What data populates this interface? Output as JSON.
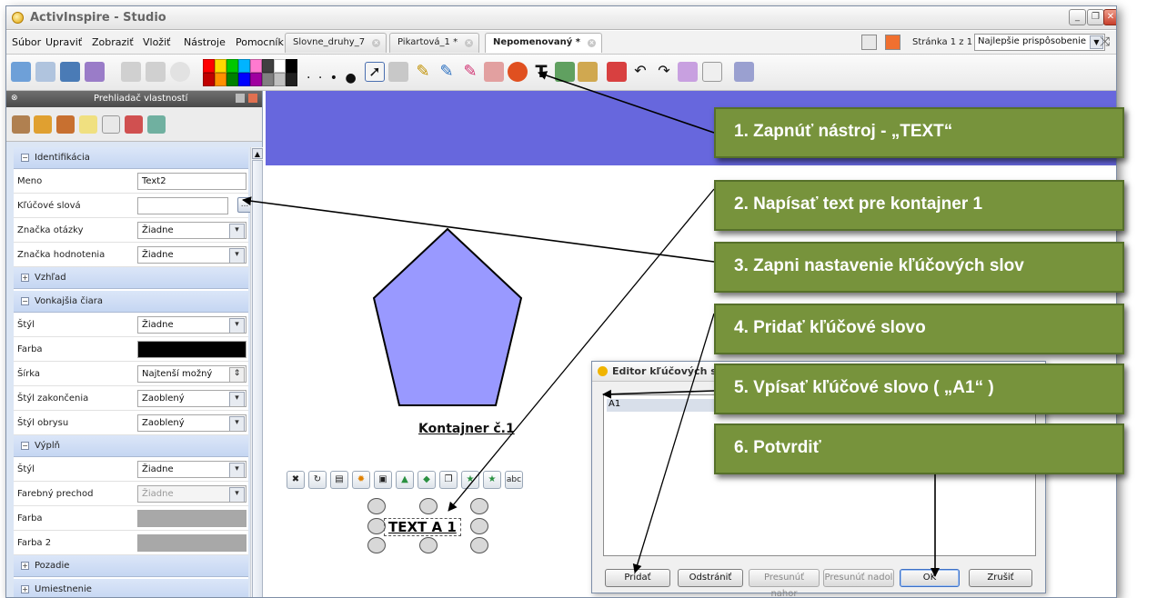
{
  "window": {
    "title": "ActivInspire - Studio"
  },
  "menu": [
    "Súbor",
    "Upraviť",
    "Zobraziť",
    "Vložiť",
    "Nástroje",
    "Pomocník"
  ],
  "tabs": [
    {
      "label": "Slovne_druhy_7",
      "active": false
    },
    {
      "label": "Pikartová_1 *",
      "active": false
    },
    {
      "label": "Nepomenovaný *",
      "active": true
    }
  ],
  "page_indicator": "Stránka 1 z 1",
  "zoom": {
    "selected": "Najlepšie prispôsobenie"
  },
  "palette_colors": [
    "#ff0000",
    "#ffd800",
    "#00c800",
    "#00b4ff",
    "#ff7ad0",
    "#404040",
    "#ffffff",
    "#000000",
    "#c00000",
    "#ff9000",
    "#008000",
    "#0000ff",
    "#a000a0",
    "#808080",
    "#c0c0c0",
    "#202020"
  ],
  "property_browser": {
    "title": "Prehliadač vlastností",
    "sections": {
      "identification": "Identifikácia",
      "appearance": "Vzhľad",
      "outline": "Vonkajšia čiara",
      "fill": "Výplň",
      "background": "Pozadie",
      "position": "Umiestnenie"
    },
    "rows": {
      "name": {
        "label": "Meno",
        "value": "Text2"
      },
      "keywords": {
        "label": "Kľúčové slová",
        "value": "",
        "button": "..."
      },
      "question_tag": {
        "label": "Značka otázky",
        "value": "Žiadne"
      },
      "rating_tag": {
        "label": "Značka hodnotenia",
        "value": "Žiadne"
      },
      "outline_style": {
        "label": "Štýl",
        "value": "Žiadne"
      },
      "outline_color": {
        "label": "Farba",
        "swatch": "#000000"
      },
      "outline_width": {
        "label": "Šírka",
        "value": "Najtenší možný"
      },
      "end_style": {
        "label": "Štýl zakončenia",
        "value": "Zaoblený"
      },
      "contour_style": {
        "label": "Štýl obrysu",
        "value": "Zaoblený"
      },
      "fill_style": {
        "label": "Štýl",
        "value": "Žiadne"
      },
      "gradient": {
        "label": "Farebný prechod",
        "value": "Žiadne"
      },
      "fill_color": {
        "label": "Farba",
        "swatch": "#a8a8a8"
      },
      "fill_color2": {
        "label": "Farba 2",
        "swatch": "#a8a8a8"
      }
    }
  },
  "canvas": {
    "band_color": "#6767dd",
    "pentagon_color": "#9999ff",
    "container_label": "Kontajner č.1",
    "text_object": "TEXT A 1"
  },
  "keyword_dialog": {
    "title": "Editor kľúčových slov",
    "items": [
      "A1"
    ],
    "buttons": {
      "add": "Pridať",
      "remove": "Odstrániť",
      "move_up": "Presunúť nahor",
      "move_down": "Presunúť nadol",
      "ok": "OK",
      "cancel": "Zrušiť"
    }
  },
  "callouts": [
    "1. Zapnúť nástroj - „TEXT“",
    "2. Napísať text pre kontajner 1",
    "3. Zapni nastavenie kľúčových slov",
    "4. Pridať kľúčové slovo",
    "5. Vpísať kľúčové slovo ( „A1“ )",
    "6. Potvrdiť"
  ]
}
